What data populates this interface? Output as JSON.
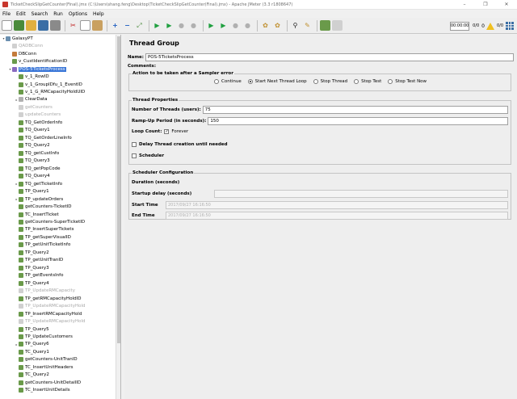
{
  "window": {
    "title": "TicketCheckSlipGetCounter(Final).jmx (C:\\Users\\shang.feng\\Desktop\\TicketCheckSlipGetCounter(Final).jmx) - Apache JMeter (3.3 r1808647)",
    "minimize": "–",
    "maximize": "❐",
    "close": "✕"
  },
  "menu": [
    "File",
    "Edit",
    "Search",
    "Run",
    "Options",
    "Help"
  ],
  "toolbar_right": {
    "elapsed": "00:00:00",
    "active": "0/0",
    "warnings": "0",
    "threads": "0/0"
  },
  "tree": [
    {
      "label": "GalaxyPT",
      "level": 0,
      "icon": "root",
      "exp": "▾",
      "state": "normal"
    },
    {
      "label": "QADBConn",
      "level": 1,
      "icon": "dis",
      "exp": "",
      "state": "disabled"
    },
    {
      "label": "DBConn",
      "level": 1,
      "icon": "cfg",
      "exp": "",
      "state": "normal"
    },
    {
      "label": "v_CustIdentificationID",
      "level": 1,
      "icon": "pen",
      "exp": "",
      "state": "normal"
    },
    {
      "label": "POS-5TicketsProcess",
      "level": 1,
      "icon": "thread",
      "exp": "▾",
      "state": "selected"
    },
    {
      "label": "v_1_RowID",
      "level": 2,
      "icon": "pen",
      "exp": "",
      "state": "normal"
    },
    {
      "label": "v_1_GroupIDfu_1_EventID",
      "level": 2,
      "icon": "pen",
      "exp": "",
      "state": "normal"
    },
    {
      "label": "v_1_G_RMCapacityHoldUID",
      "level": 2,
      "icon": "pen",
      "exp": "",
      "state": "normal"
    },
    {
      "label": "ClearData",
      "level": 2,
      "icon": "ctrl",
      "exp": "▸",
      "state": "normal"
    },
    {
      "label": "getCounters",
      "level": 2,
      "icon": "dis",
      "exp": "",
      "state": "disabled"
    },
    {
      "label": "updateCounters",
      "level": 2,
      "icon": "dis",
      "exp": "",
      "state": "disabled"
    },
    {
      "label": "TQ_GetOrderInfo",
      "level": 2,
      "icon": "pen",
      "exp": "",
      "state": "normal"
    },
    {
      "label": "TQ_Query1",
      "level": 2,
      "icon": "pen",
      "exp": "",
      "state": "normal"
    },
    {
      "label": "TQ_GetOrderLineInfo",
      "level": 2,
      "icon": "pen",
      "exp": "",
      "state": "normal"
    },
    {
      "label": "TQ_Query2",
      "level": 2,
      "icon": "pen",
      "exp": "",
      "state": "normal"
    },
    {
      "label": "TQ_getCustInfo",
      "level": 2,
      "icon": "pen",
      "exp": "",
      "state": "normal"
    },
    {
      "label": "TQ_Query3",
      "level": 2,
      "icon": "pen",
      "exp": "",
      "state": "normal"
    },
    {
      "label": "TQ_getPopCode",
      "level": 2,
      "icon": "pen",
      "exp": "",
      "state": "normal"
    },
    {
      "label": "TQ_Query4",
      "level": 2,
      "icon": "pen",
      "exp": "",
      "state": "normal"
    },
    {
      "label": "TQ_getTicketInfo",
      "level": 2,
      "icon": "pen",
      "exp": "▸",
      "state": "normal"
    },
    {
      "label": "TP_Query1",
      "level": 2,
      "icon": "pen",
      "exp": "",
      "state": "normal"
    },
    {
      "label": "TP_updateOrders",
      "level": 2,
      "icon": "pen",
      "exp": "▸",
      "state": "normal"
    },
    {
      "label": "getCounters-TicketID",
      "level": 2,
      "icon": "pen",
      "exp": "",
      "state": "normal"
    },
    {
      "label": "TC_InsertTicket",
      "level": 2,
      "icon": "pen",
      "exp": "",
      "state": "normal"
    },
    {
      "label": "getCounters-SuperTicketID",
      "level": 2,
      "icon": "pen",
      "exp": "",
      "state": "normal"
    },
    {
      "label": "TP_InsertSuperTickets",
      "level": 2,
      "icon": "pen",
      "exp": "",
      "state": "normal"
    },
    {
      "label": "TP_getSuperVisualID",
      "level": 2,
      "icon": "pen",
      "exp": "",
      "state": "normal"
    },
    {
      "label": "TP_getUnitTicketInfo",
      "level": 2,
      "icon": "pen",
      "exp": "",
      "state": "normal"
    },
    {
      "label": "TP_Query2",
      "level": 2,
      "icon": "pen",
      "exp": "",
      "state": "normal"
    },
    {
      "label": "TP_getUnitTranID",
      "level": 2,
      "icon": "pen",
      "exp": "",
      "state": "normal"
    },
    {
      "label": "TP_Query3",
      "level": 2,
      "icon": "pen",
      "exp": "",
      "state": "normal"
    },
    {
      "label": "TP_getEventsInfo",
      "level": 2,
      "icon": "pen",
      "exp": "",
      "state": "normal"
    },
    {
      "label": "TP_Query4",
      "level": 2,
      "icon": "pen",
      "exp": "",
      "state": "normal"
    },
    {
      "label": "TP_UpdateRMCapacity",
      "level": 2,
      "icon": "dis",
      "exp": "",
      "state": "disabled"
    },
    {
      "label": "TP_getRMCapacityHoldID",
      "level": 2,
      "icon": "pen",
      "exp": "",
      "state": "normal"
    },
    {
      "label": "TP_UpdateRMCapacityHold",
      "level": 2,
      "icon": "dis",
      "exp": "",
      "state": "disabled"
    },
    {
      "label": "TP_InsertRMCapacityHold",
      "level": 2,
      "icon": "pen",
      "exp": "",
      "state": "normal"
    },
    {
      "label": "TP_UpdateRMCapacityHold",
      "level": 2,
      "icon": "dis",
      "exp": "",
      "state": "disabled"
    },
    {
      "label": "TP_Query5",
      "level": 2,
      "icon": "pen",
      "exp": "",
      "state": "normal"
    },
    {
      "label": "TP_UpdateCustomers",
      "level": 2,
      "icon": "pen",
      "exp": "",
      "state": "normal"
    },
    {
      "label": "TP_Query6",
      "level": 2,
      "icon": "pen",
      "exp": "▸",
      "state": "normal"
    },
    {
      "label": "TC_Query1",
      "level": 2,
      "icon": "pen",
      "exp": "",
      "state": "normal"
    },
    {
      "label": "getCounters-UnitTranID",
      "level": 2,
      "icon": "pen",
      "exp": "",
      "state": "normal"
    },
    {
      "label": "TC_InsertUnitHeaders",
      "level": 2,
      "icon": "pen",
      "exp": "",
      "state": "normal"
    },
    {
      "label": "TC_Query2",
      "level": 2,
      "icon": "pen",
      "exp": "",
      "state": "normal"
    },
    {
      "label": "getCounters-UnitDetailID",
      "level": 2,
      "icon": "pen",
      "exp": "",
      "state": "normal"
    },
    {
      "label": "TC_InsertUnitDetails",
      "level": 2,
      "icon": "pen",
      "exp": "",
      "state": "normal"
    }
  ],
  "panel": {
    "title": "Thread Group",
    "name_label": "Name:",
    "name_value": "POS-5TicketsProcess",
    "comments_label": "Comments:",
    "comments_value": "",
    "sampler_error": {
      "legend": "Action to be taken after a Sampler error",
      "options": [
        "Continue",
        "Start Next Thread Loop",
        "Stop Thread",
        "Stop Test",
        "Stop Test Now"
      ],
      "selected_index": 1
    },
    "thread_props": {
      "legend": "Thread Properties",
      "threads_label": "Number of Threads (users):",
      "threads_value": "75",
      "rampup_label": "Ramp-Up Period (in seconds):",
      "rampup_value": "150",
      "loop_label": "Loop Count:",
      "forever_label": "Forever",
      "forever_checked": true,
      "delay_label": "Delay Thread creation until needed",
      "delay_checked": false,
      "scheduler_label": "Scheduler",
      "scheduler_checked": false
    },
    "scheduler": {
      "legend": "Scheduler Configuration",
      "duration_label": "Duration (seconds)",
      "startup_label": "Startup delay (seconds)",
      "start_label": "Start Time",
      "start_value": "2017/09/27 16:16:50",
      "end_label": "End Time",
      "end_value": "2017/09/27 16:16:50"
    }
  },
  "colors": {
    "selection": "#3875d7",
    "disabled_text": "#a8a8a8"
  }
}
